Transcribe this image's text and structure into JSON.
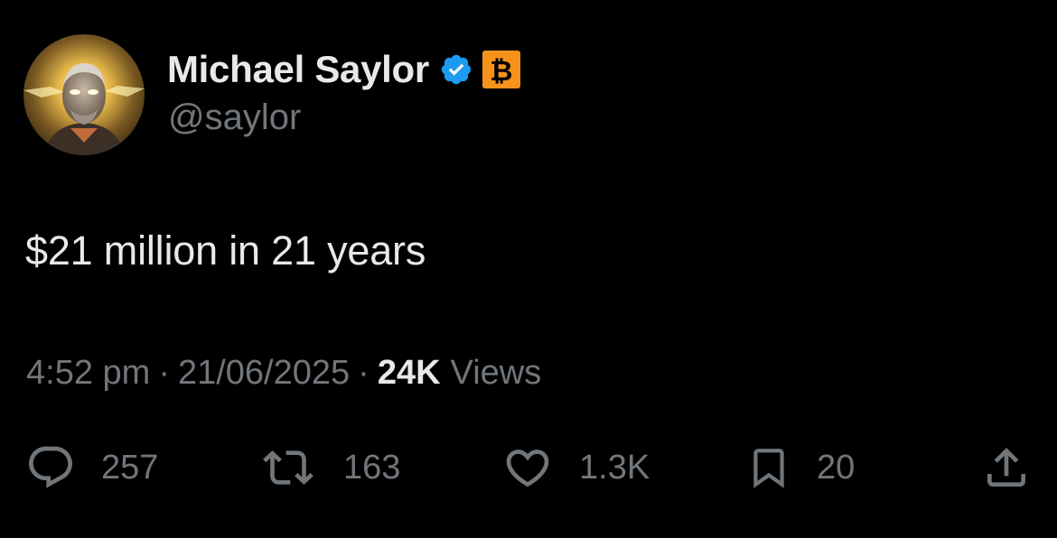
{
  "author": {
    "display_name": "Michael Saylor",
    "handle": "@saylor",
    "verified_badge": "verified-checkmark-icon",
    "affiliation_badge": {
      "icon": "bitcoin-badge-icon",
      "glyph": "₿",
      "color": "#f7931a"
    }
  },
  "tweet": {
    "text": "$21 million in 21 years"
  },
  "meta": {
    "time": "4:52 pm",
    "separator": "·",
    "date": "21/06/2025",
    "views_count": "24K",
    "views_label": "Views"
  },
  "actions": {
    "replies": {
      "icon": "reply-icon",
      "count": "257"
    },
    "reposts": {
      "icon": "repost-icon",
      "count": "163"
    },
    "likes": {
      "icon": "heart-icon",
      "count": "1.3K"
    },
    "bookmarks": {
      "icon": "bookmark-icon",
      "count": "20"
    },
    "share": {
      "icon": "share-icon"
    }
  },
  "colors": {
    "background": "#000000",
    "primary_text": "#e7e9ea",
    "secondary_text": "#71767b",
    "verified_blue": "#1d9bf0",
    "bitcoin_orange": "#f7931a"
  }
}
